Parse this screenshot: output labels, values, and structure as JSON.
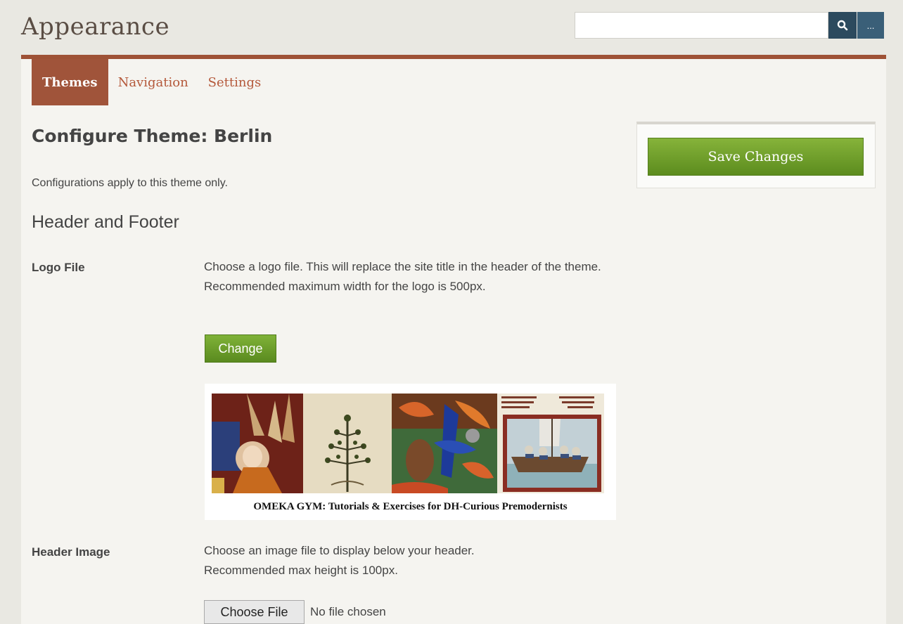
{
  "header": {
    "title": "Appearance",
    "search": {
      "value": "",
      "placeholder": ""
    },
    "search_icon": "search-icon",
    "more_label": "..."
  },
  "tabs": [
    {
      "label": "Themes",
      "active": true
    },
    {
      "label": "Navigation",
      "active": false
    },
    {
      "label": "Settings",
      "active": false
    }
  ],
  "main": {
    "title": "Configure Theme: Berlin",
    "note": "Configurations apply to this theme only.",
    "section": "Header and Footer",
    "logo_file": {
      "label": "Logo File",
      "description": "Choose a logo file. This will replace the site title in the header of the theme. Recommended maximum width for the logo is 500px.",
      "change_label": "Change",
      "caption": "OMEKA GYM:  Tutorials & Exercises for DH-Curious Premodernists"
    },
    "header_image": {
      "label": "Header Image",
      "description": "Choose an image file to display below your header. Recommended max height is 100px.",
      "choose_label": "Choose File",
      "status": "No file chosen"
    }
  },
  "sidebar": {
    "save_label": "Save Changes"
  },
  "colors": {
    "accent": "#a0543a",
    "save_green": "#6fa02b",
    "search_button": "#2c4a5e"
  }
}
